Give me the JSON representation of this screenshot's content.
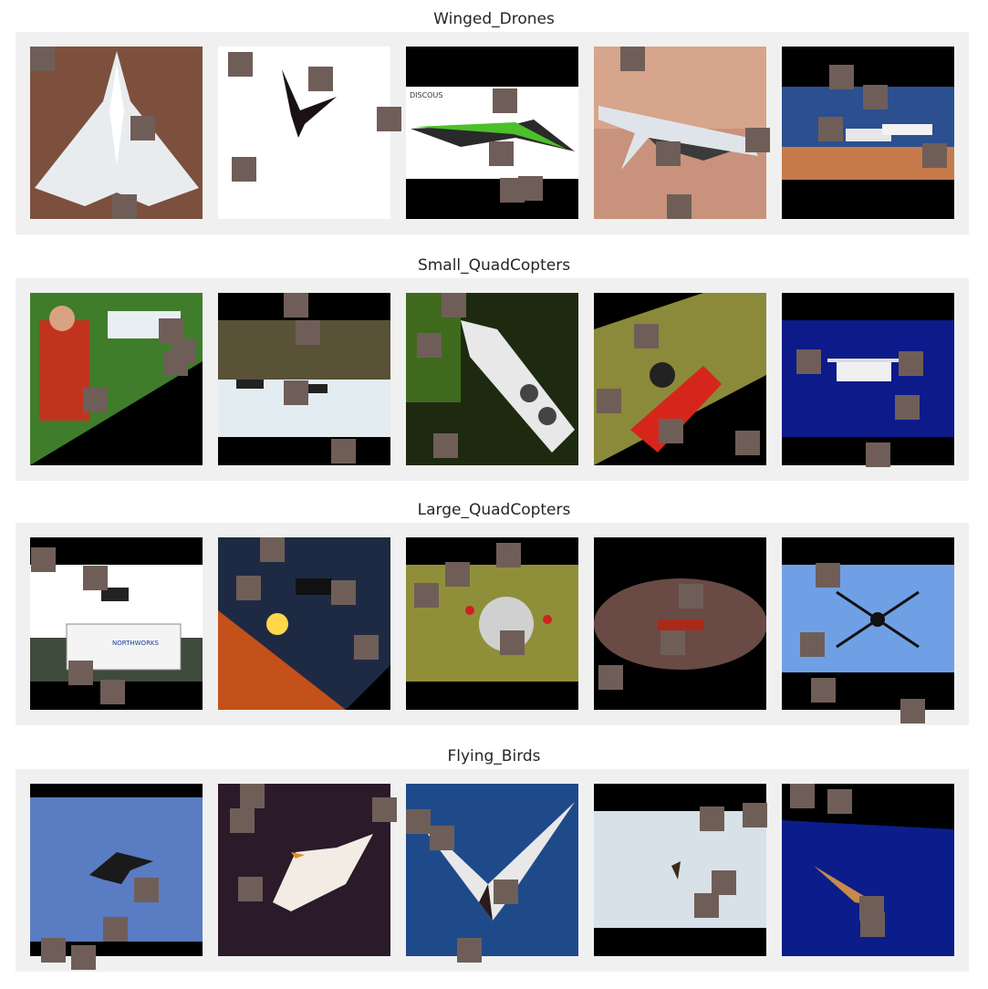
{
  "colors": {
    "background": "#ffffff",
    "strip": "#f0f0f0",
    "patch": "#6f5e58",
    "title": "#262626"
  },
  "rows": [
    {
      "title": "Winged_Drones",
      "tiles": [
        {
          "name": "winged-drone-1",
          "bg": "#8a5a45",
          "subject": "flying-wing"
        },
        {
          "name": "winged-drone-2",
          "bg": "#ffffff",
          "subject": "dark-silhouette"
        },
        {
          "name": "winged-drone-3",
          "bg": "#ffffff",
          "subject": "green-wing",
          "logo": "DISCOUS"
        },
        {
          "name": "winged-drone-4",
          "bg": "#c9927c",
          "subject": "jet"
        },
        {
          "name": "winged-drone-5",
          "bg": "#2b4f8f",
          "subject": "twin-aircraft"
        }
      ]
    },
    {
      "title": "Small_QuadCopters",
      "tiles": [
        {
          "name": "small-quad-1",
          "bg": "#3f7d2a",
          "subject": "person-with-drone"
        },
        {
          "name": "small-quad-2",
          "bg": "#5a5236",
          "subject": "racing-quads"
        },
        {
          "name": "small-quad-3",
          "bg": "#1d2a10",
          "subject": "white-quad-wheels"
        },
        {
          "name": "small-quad-4",
          "bg": "#7c8a3c",
          "subject": "red-quad"
        },
        {
          "name": "small-quad-5",
          "bg": "#0d1a8a",
          "subject": "white-quad"
        }
      ]
    },
    {
      "title": "Large_QuadCopters",
      "tiles": [
        {
          "name": "large-quad-1",
          "bg": "#ffffff",
          "subject": "truck-and-drone",
          "logo": "NORTHWORKS"
        },
        {
          "name": "large-quad-2",
          "bg": "#d97a1e",
          "subject": "sunset-drone"
        },
        {
          "name": "large-quad-3",
          "bg": "#8f8f3a",
          "subject": "hexacopter-on-grass"
        },
        {
          "name": "large-quad-4",
          "bg": "#3a2a2a",
          "subject": "low-flying-drone"
        },
        {
          "name": "large-quad-5",
          "bg": "#6fa0e6",
          "subject": "octocopter"
        }
      ]
    },
    {
      "title": "Flying_Birds",
      "tiles": [
        {
          "name": "bird-1",
          "bg": "#5a7cc2",
          "subject": "dark-bird"
        },
        {
          "name": "bird-2",
          "bg": "#2a1a2a",
          "subject": "pelican"
        },
        {
          "name": "bird-3",
          "bg": "#1f4a8a",
          "subject": "tern"
        },
        {
          "name": "bird-4",
          "bg": "#d8e0e8",
          "subject": "distant-bird"
        },
        {
          "name": "bird-5",
          "bg": "#0b1d8a",
          "subject": "hawk"
        }
      ]
    }
  ]
}
